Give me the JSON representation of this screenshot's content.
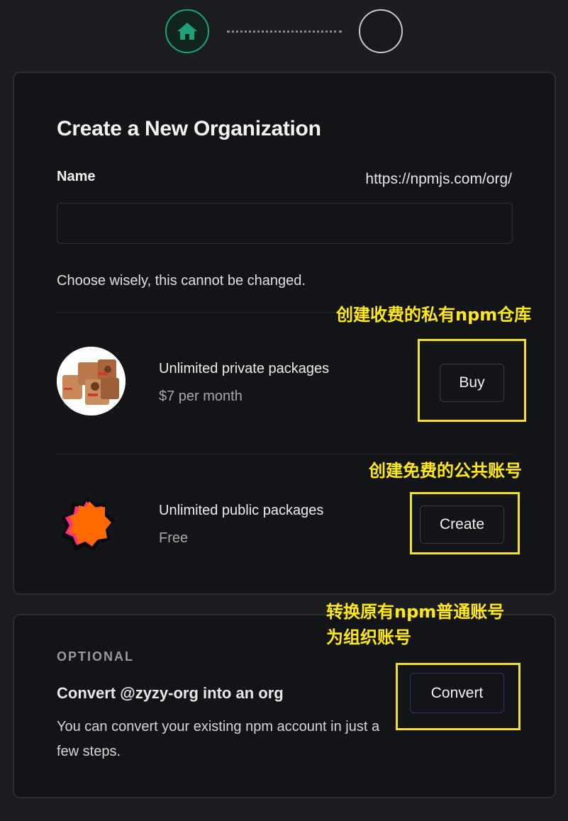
{
  "stepper": {
    "step1_icon": "home-icon",
    "step2_icon": "empty-circle",
    "accent_color": "#1fa27a"
  },
  "create_org": {
    "title": "Create a New Organization",
    "name_label": "Name",
    "url_prefix": "https://npmjs.com/org/",
    "name_value": "",
    "hint": "Choose wisely, this cannot be changed.",
    "plans": [
      {
        "title": "Unlimited private packages",
        "price": "$7 per month",
        "button_label": "Buy",
        "icon": "boxes-avatar-icon"
      },
      {
        "title": "Unlimited public packages",
        "price": "Free",
        "button_label": "Create",
        "icon": "orange-blob-icon"
      }
    ]
  },
  "optional": {
    "label": "OPTIONAL",
    "title": "Convert @zyzy-org into an org",
    "description": "You can convert your existing npm account in just a few steps.",
    "button_label": "Convert"
  },
  "annotations": {
    "buy_note": "创建收费的私有npm仓库",
    "create_note": "创建免费的公共账号",
    "convert_note_line1": "转换原有npm普通账号",
    "convert_note_line2": "为组织账号",
    "highlight_color": "#f3e12b"
  }
}
